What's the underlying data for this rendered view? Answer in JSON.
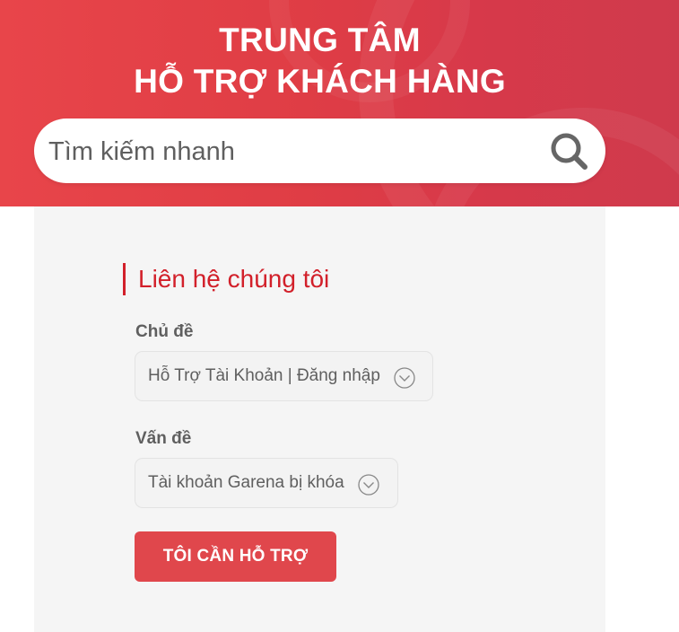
{
  "header": {
    "title_line1": "TRUNG TÂM",
    "title_line2": "HỖ TRỢ KHÁCH HÀNG",
    "background_color": "#df3d45",
    "search": {
      "placeholder": "Tìm kiếm nhanh",
      "value": "",
      "icon": "search-icon"
    }
  },
  "contact": {
    "title": "Liên hệ chúng tôi",
    "accent_color": "#d2202a",
    "topic": {
      "label": "Chủ đề",
      "selected": "Hỗ Trợ Tài Khoản | Đăng nhập",
      "icon": "chevron-down-icon"
    },
    "issue": {
      "label": "Vấn đề",
      "selected": "Tài khoản Garena bị khóa",
      "icon": "chevron-down-icon"
    },
    "submit_label": "TÔI CẦN HỖ TRỢ",
    "submit_color": "#e0474c"
  }
}
